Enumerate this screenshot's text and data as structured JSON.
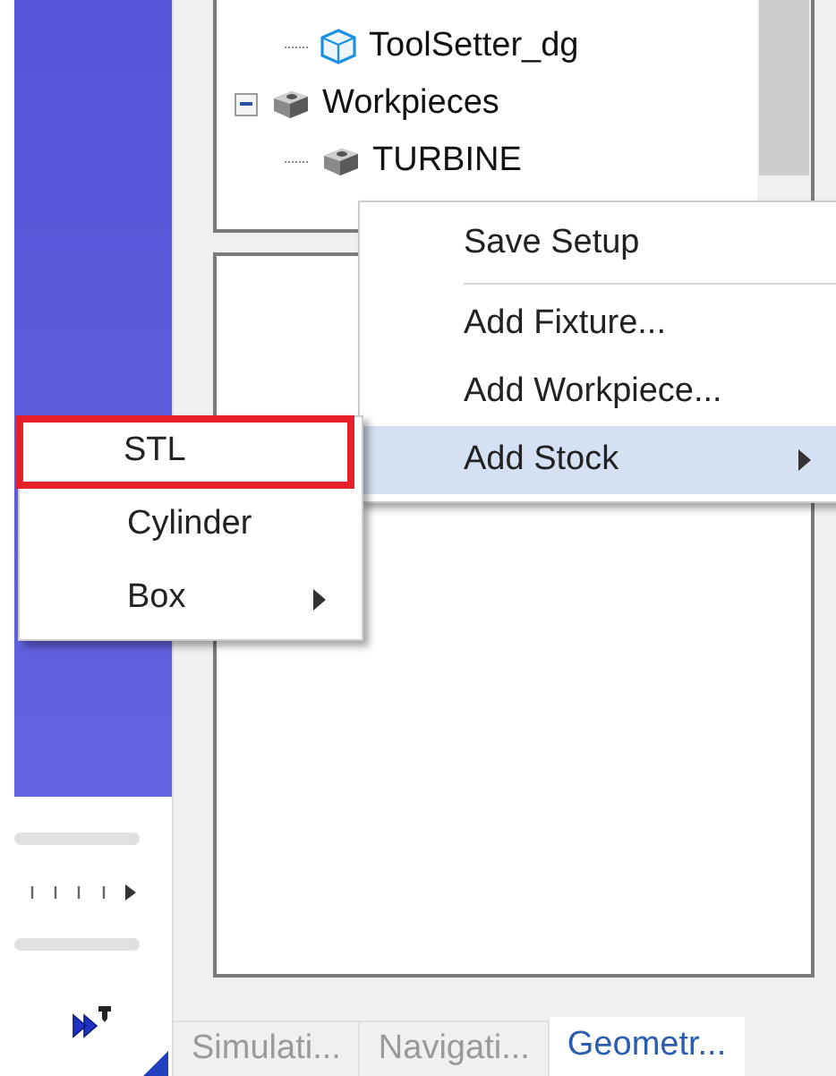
{
  "tree": [
    {
      "children": [
        {
          "label": "ToolSetter_dg",
          "kind": "cube"
        }
      ]
    },
    {
      "label": "Workpieces",
      "kind": "block",
      "expanded": true,
      "children": [
        {
          "label": "TURBINE",
          "kind": "block"
        }
      ]
    }
  ],
  "context_menu": {
    "items": [
      {
        "label": "Save Setup",
        "selected": false,
        "separator_after": true,
        "submenu": false
      },
      {
        "label": "Add Fixture...",
        "selected": false,
        "separator_after": false,
        "submenu": false
      },
      {
        "label": "Add Workpiece...",
        "selected": false,
        "separator_after": false,
        "submenu": false
      },
      {
        "label": "Add Stock",
        "selected": true,
        "separator_after": false,
        "submenu": true
      }
    ]
  },
  "submenu": {
    "items": [
      {
        "label": "STL",
        "selected": true,
        "submenu": false
      },
      {
        "label": "Cylinder",
        "selected": false,
        "submenu": false
      },
      {
        "label": "Box",
        "selected": false,
        "submenu": true
      }
    ]
  },
  "tabs": [
    {
      "label": "Simulati...",
      "selected": false
    },
    {
      "label": "Navigati...",
      "selected": false
    },
    {
      "label": "Geometr...",
      "selected": true
    }
  ]
}
